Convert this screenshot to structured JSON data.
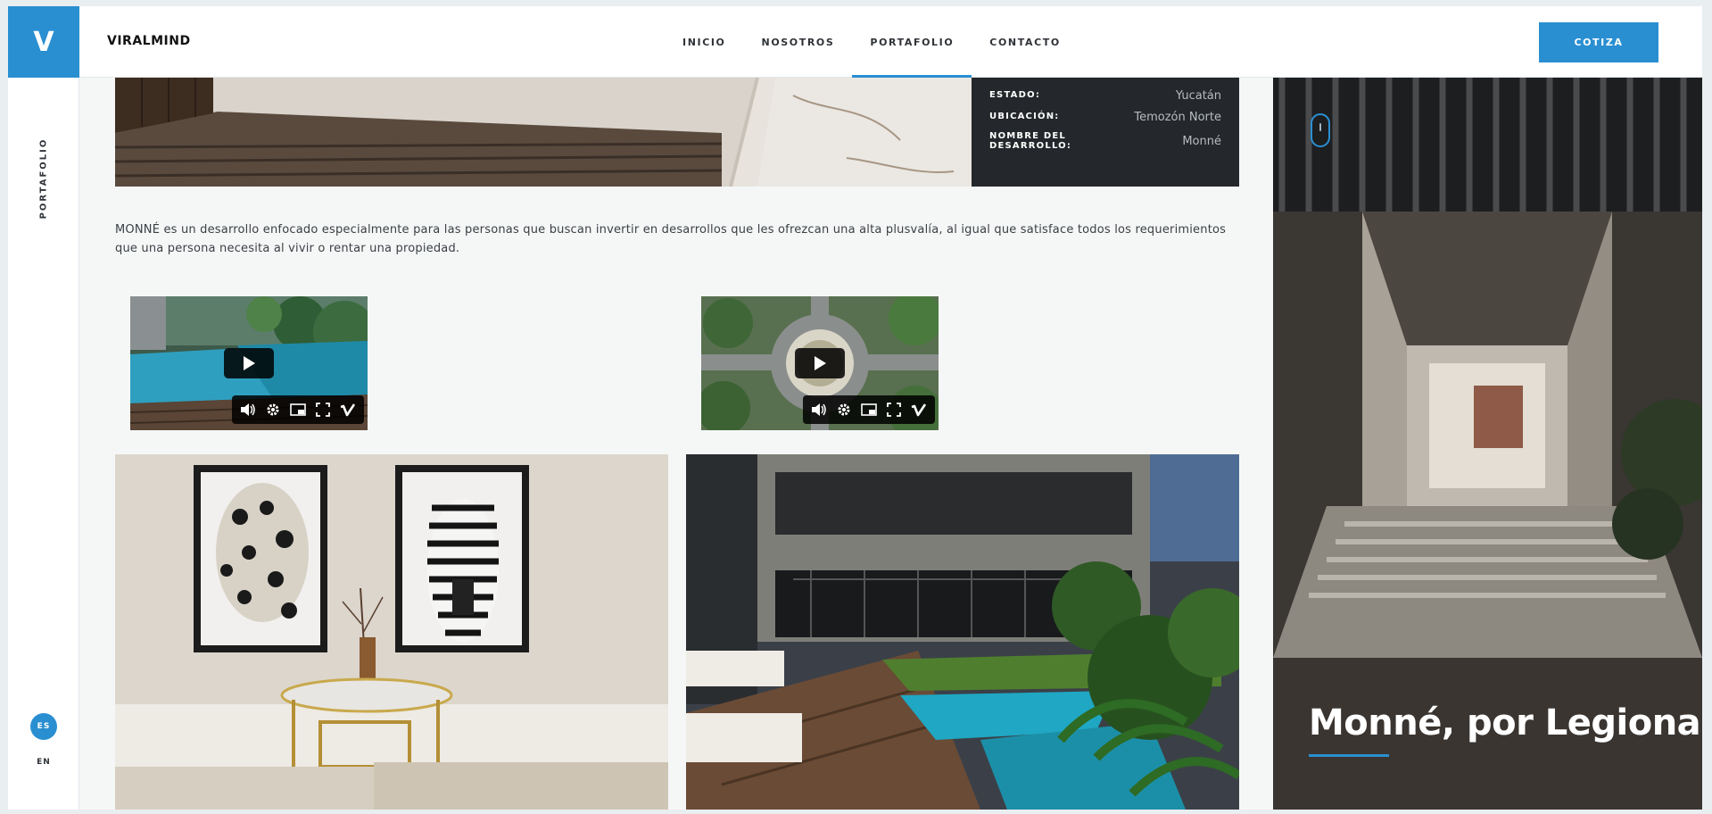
{
  "header": {
    "logo_letter": "V",
    "brand": "VIRALMIND",
    "nav": [
      {
        "label": "INICIO",
        "active": false
      },
      {
        "label": "NOSOTROS",
        "active": false
      },
      {
        "label": "PORTAFOLIO",
        "active": true
      },
      {
        "label": "CONTACTO",
        "active": false
      }
    ],
    "cta_label": "COTIZA"
  },
  "rail": {
    "section_label": "PORTAFOLIO",
    "languages": [
      {
        "code": "ES",
        "active": true
      },
      {
        "code": "EN",
        "active": false
      }
    ]
  },
  "project_info": {
    "rows": [
      {
        "label": "ESTADO:",
        "value": "Yucatán"
      },
      {
        "label": "UBICACIÓN:",
        "value": "Temozón Norte"
      },
      {
        "label": "NOMBRE DEL DESARROLLO:",
        "value": "Monné"
      }
    ]
  },
  "description": "MONNÉ es un desarrollo enfocado especialmente para las personas que buscan invertir en desarrollos que les ofrezcan una alta plusvalía, al igual que satisface todos los requerimientos que una persona necesita al vivir o rentar una propiedad.",
  "videos": [
    {
      "controls": [
        "volume-icon",
        "settings-icon",
        "pip-icon",
        "fullscreen-icon",
        "vimeo-icon"
      ]
    },
    {
      "controls": [
        "volume-icon",
        "settings-icon",
        "pip-icon",
        "fullscreen-icon",
        "vimeo-icon"
      ]
    }
  ],
  "hero": {
    "title": "Monné, por Legiona"
  },
  "colors": {
    "accent": "#2a8fd1",
    "dark_panel": "#24272b",
    "page_bg": "#f5f7f7"
  }
}
